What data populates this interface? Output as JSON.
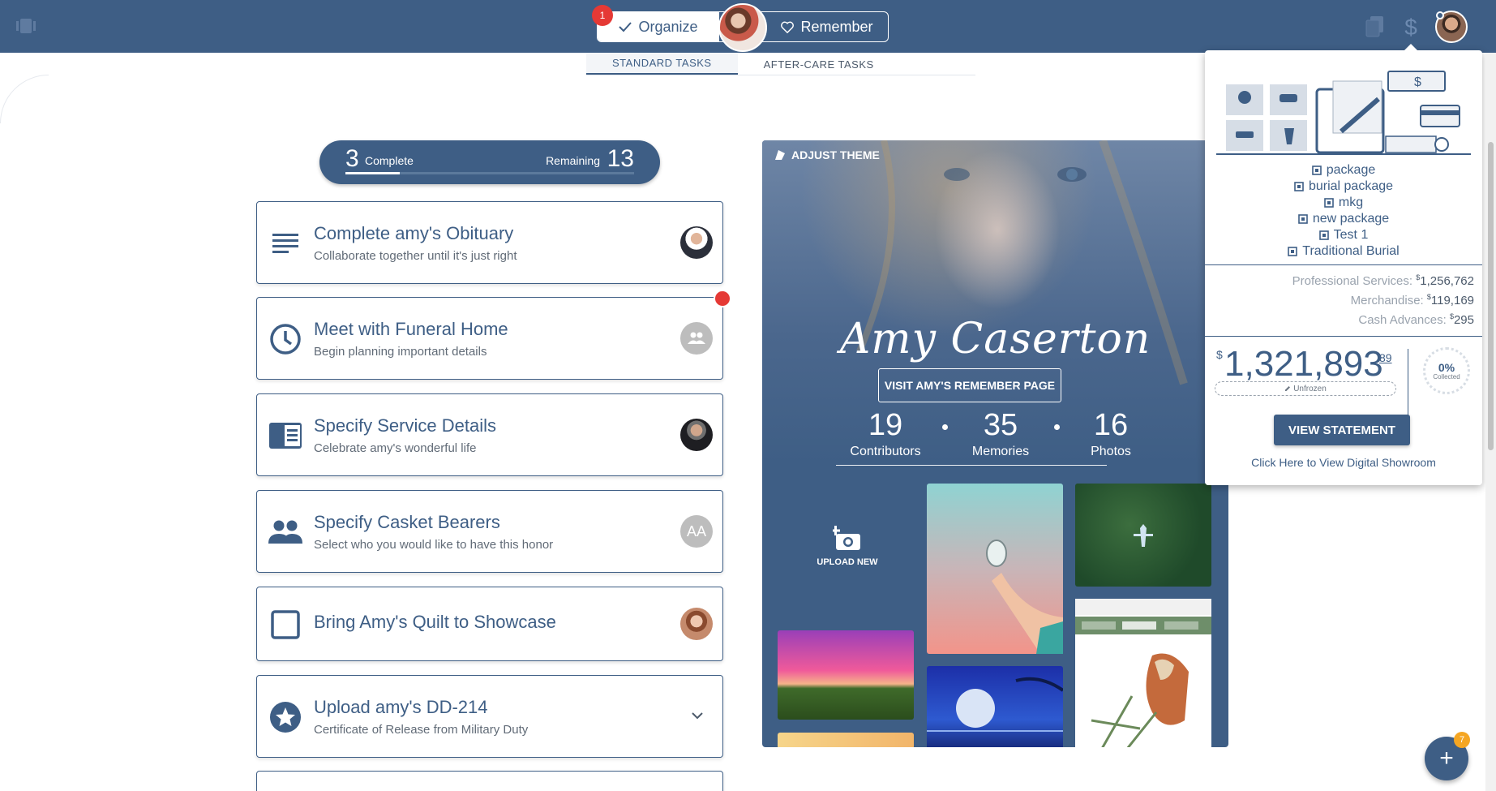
{
  "header": {
    "modes": {
      "organize_label": "Organize",
      "remember_label": "Remember",
      "organize_badge": "1"
    },
    "tabs": [
      {
        "label": "STANDARD TASKS",
        "active": true
      },
      {
        "label": "AFTER-CARE TASKS",
        "active": false
      }
    ]
  },
  "progress": {
    "complete_count": "3",
    "complete_label": "Complete",
    "remaining_label": "Remaining",
    "remaining_count": "13",
    "fraction_complete": 0.1875
  },
  "tasks": [
    {
      "title": "Complete amy's Obituary",
      "subtitle": "Collaborate together until it's just right",
      "icon": "notes-icon",
      "assignee": "photo"
    },
    {
      "title": "Meet with Funeral Home",
      "subtitle": "Begin planning important details",
      "icon": "clock-icon",
      "assignee": "group-icon"
    },
    {
      "title": "Specify Service Details",
      "subtitle": "Celebrate amy's wonderful life",
      "icon": "program-icon",
      "assignee": "photo"
    },
    {
      "title": "Specify Casket Bearers",
      "subtitle": "Select who you would like to have this honor",
      "icon": "people-icon",
      "assignee": "AA"
    },
    {
      "title": "Bring Amy's Quilt to Showcase",
      "subtitle": "",
      "icon": "checkbox-icon",
      "assignee": "photo"
    },
    {
      "title": "Upload amy's DD-214",
      "subtitle": "Certificate of Release from Military Duty",
      "icon": "star-icon",
      "assignee": "chevron-down-icon"
    }
  ],
  "memorial": {
    "adjust_theme": "ADJUST THEME",
    "name": "Amy Caserton",
    "visit_button": "VISIT AMY'S REMEMBER PAGE",
    "stats": [
      {
        "value": "19",
        "label": "Contributors"
      },
      {
        "value": "35",
        "label": "Memories"
      },
      {
        "value": "16",
        "label": "Photos"
      }
    ],
    "upload_label": "UPLOAD NEW"
  },
  "dropdown": {
    "packages": [
      "package",
      "burial package",
      "mkg",
      "new package",
      "Test 1",
      "Traditional Burial"
    ],
    "fees": [
      {
        "label": "Professional Services:",
        "currency": "$",
        "amount": "1,256,762"
      },
      {
        "label": "Merchandise:",
        "currency": "$",
        "amount": "119,169"
      },
      {
        "label": "Cash Advances:",
        "currency": "$",
        "amount": "295"
      }
    ],
    "total": {
      "currency": "$",
      "amount": "1,321,893",
      "cents": "89",
      "status": "Unfrozen"
    },
    "collected": {
      "percent": "0%",
      "label": "Collected"
    },
    "view_statement": "VIEW STATEMENT",
    "showroom_link": "Click Here to View Digital Showroom"
  },
  "fab": {
    "symbol": "+",
    "badge": "7"
  },
  "colors": {
    "primary": "#3e5e85",
    "alert": "#e53935",
    "badge_orange": "#f5a623"
  }
}
